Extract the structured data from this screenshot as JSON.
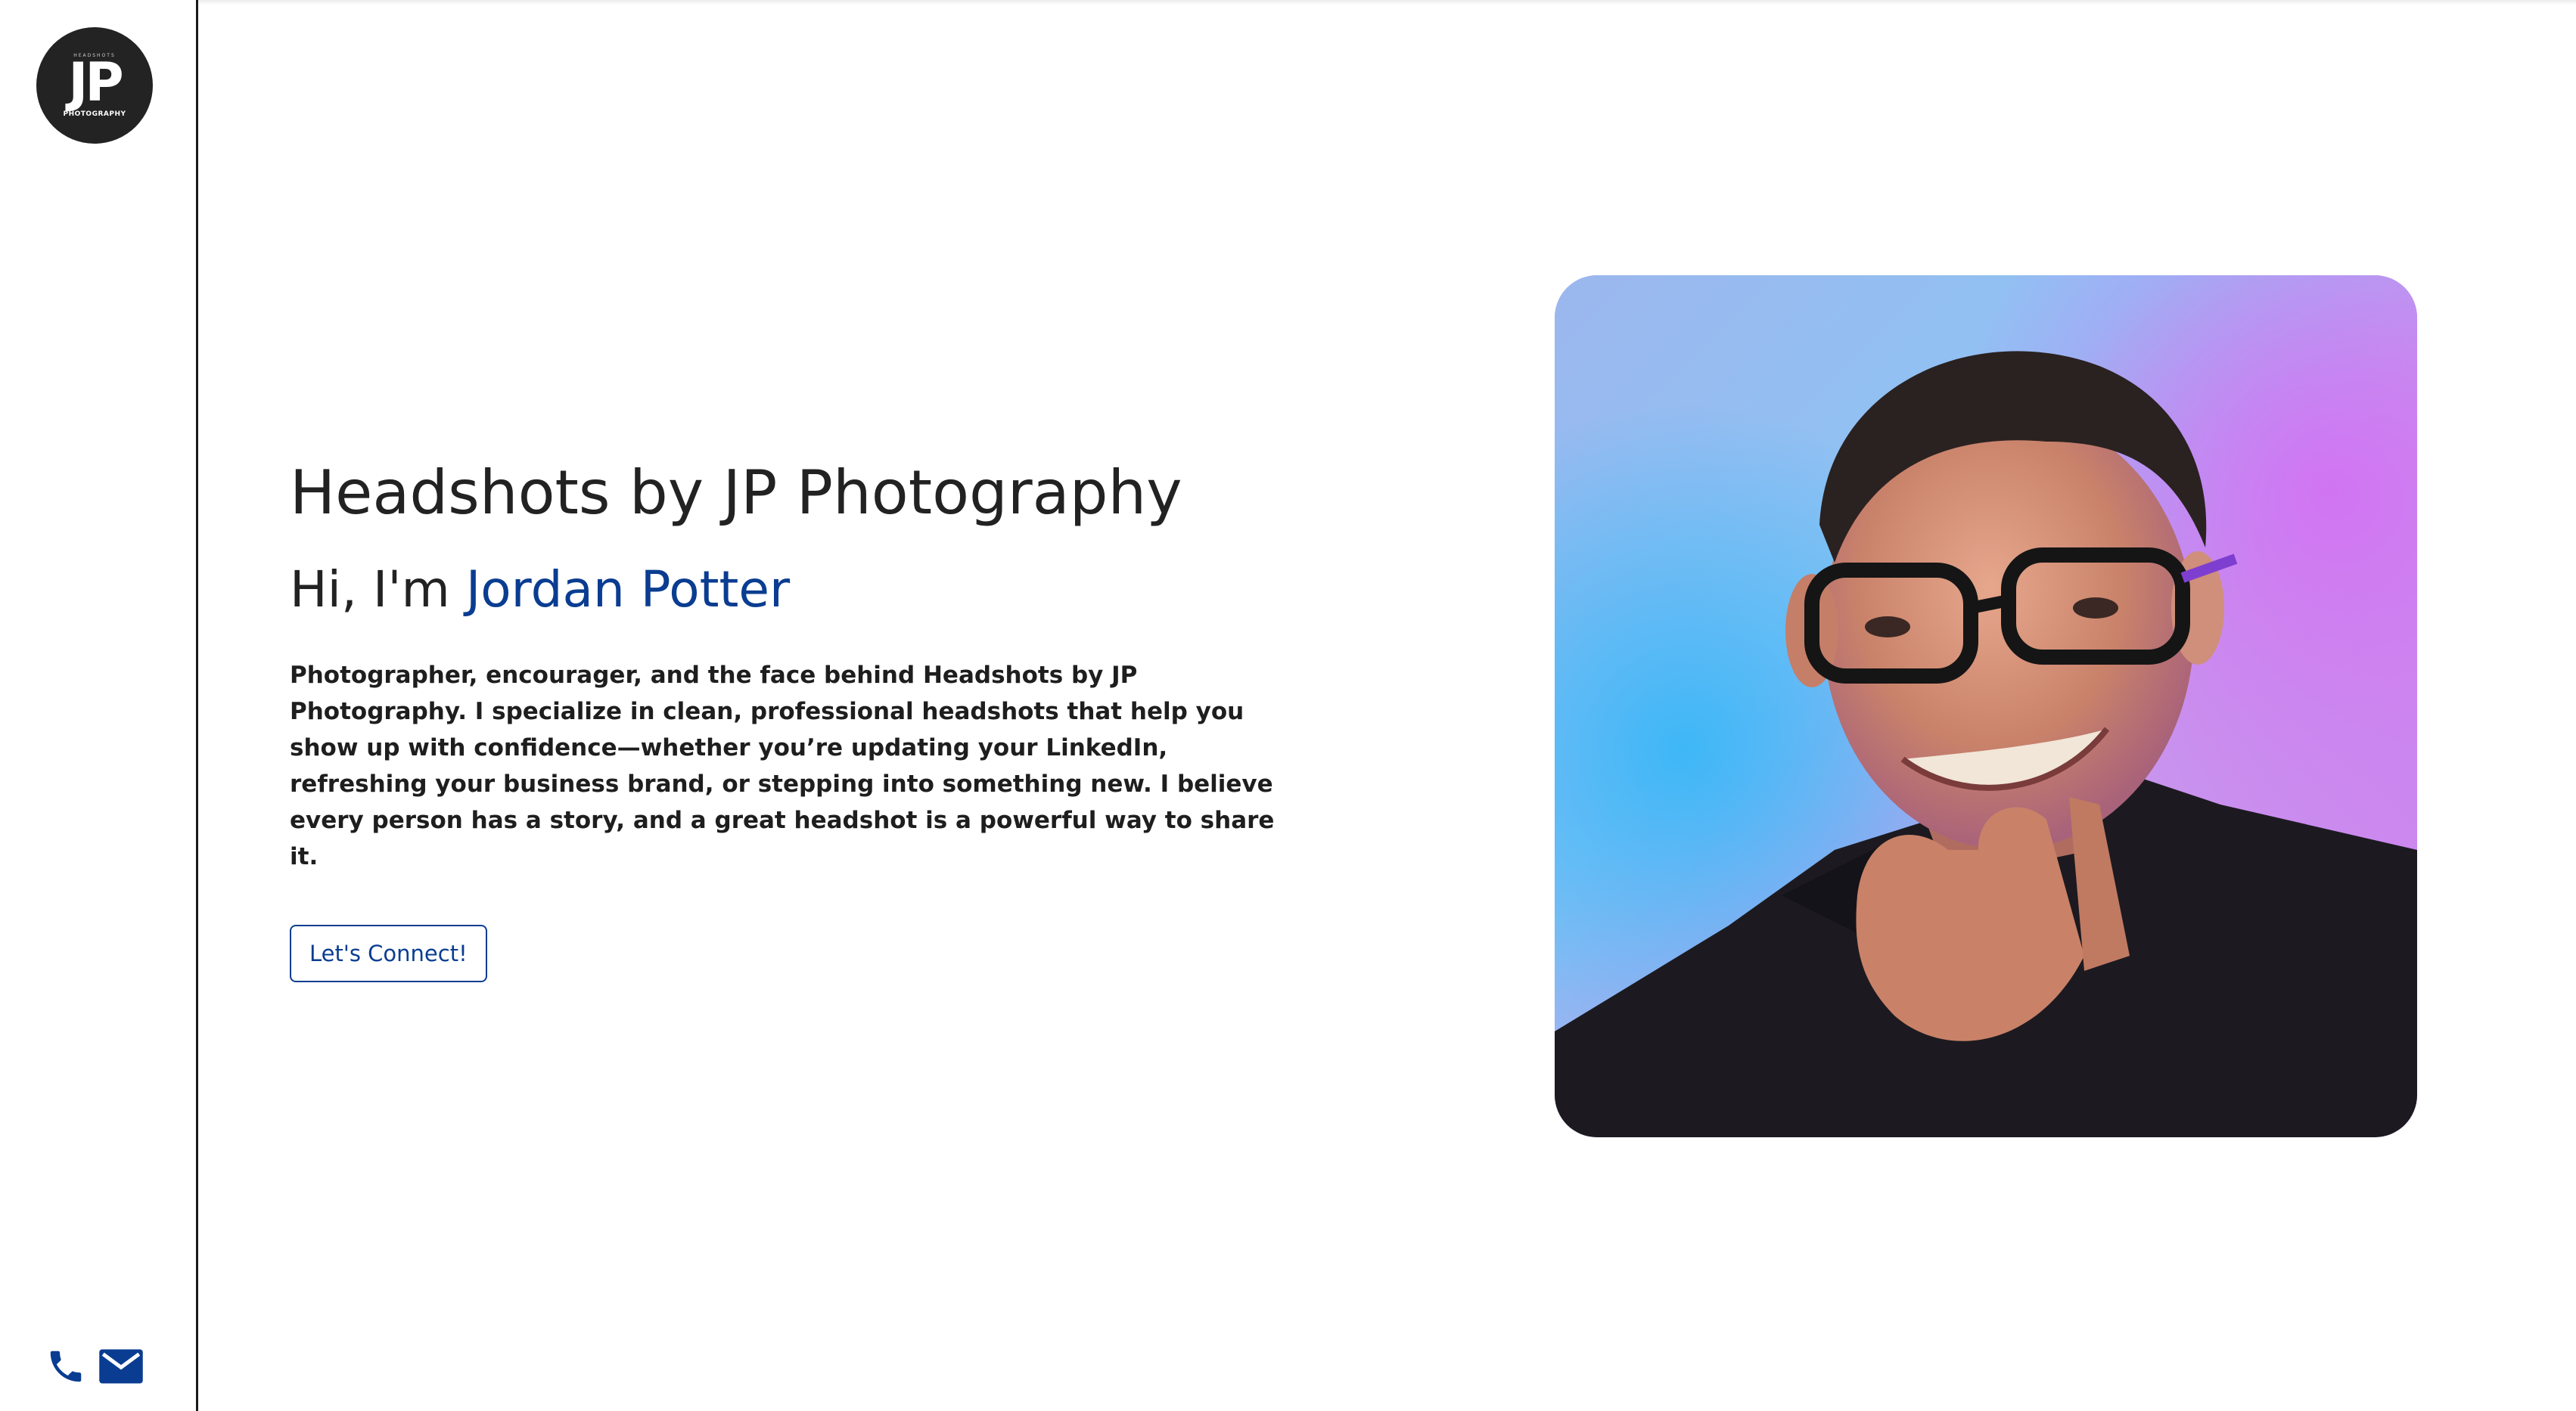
{
  "brand": {
    "logo_mark": "JP",
    "logo_subtext": "PHOTOGRAPHY",
    "logo_top_text": "HEADSHOTS"
  },
  "contact": {
    "icons": [
      "phone-icon",
      "mail-icon"
    ],
    "accent_color": "#0a3d91"
  },
  "hero": {
    "title": "Headshots by JP Photography",
    "greeting_prefix": "Hi, I'm ",
    "greeting_name": "Jordan Potter",
    "bio": "Photographer, encourager, and the face behind Headshots by JP Photography. I specialize in clean, professional headshots that help you show up with confidence—whether you’re updating your LinkedIn, refreshing your business brand, or stepping into something new. I believe every person has a story, and a great headshot is a powerful way to share it.",
    "cta_label": "Let's Connect!"
  },
  "colors": {
    "accent": "#0a3d91",
    "text": "#222222",
    "logo_bg": "#232323"
  }
}
